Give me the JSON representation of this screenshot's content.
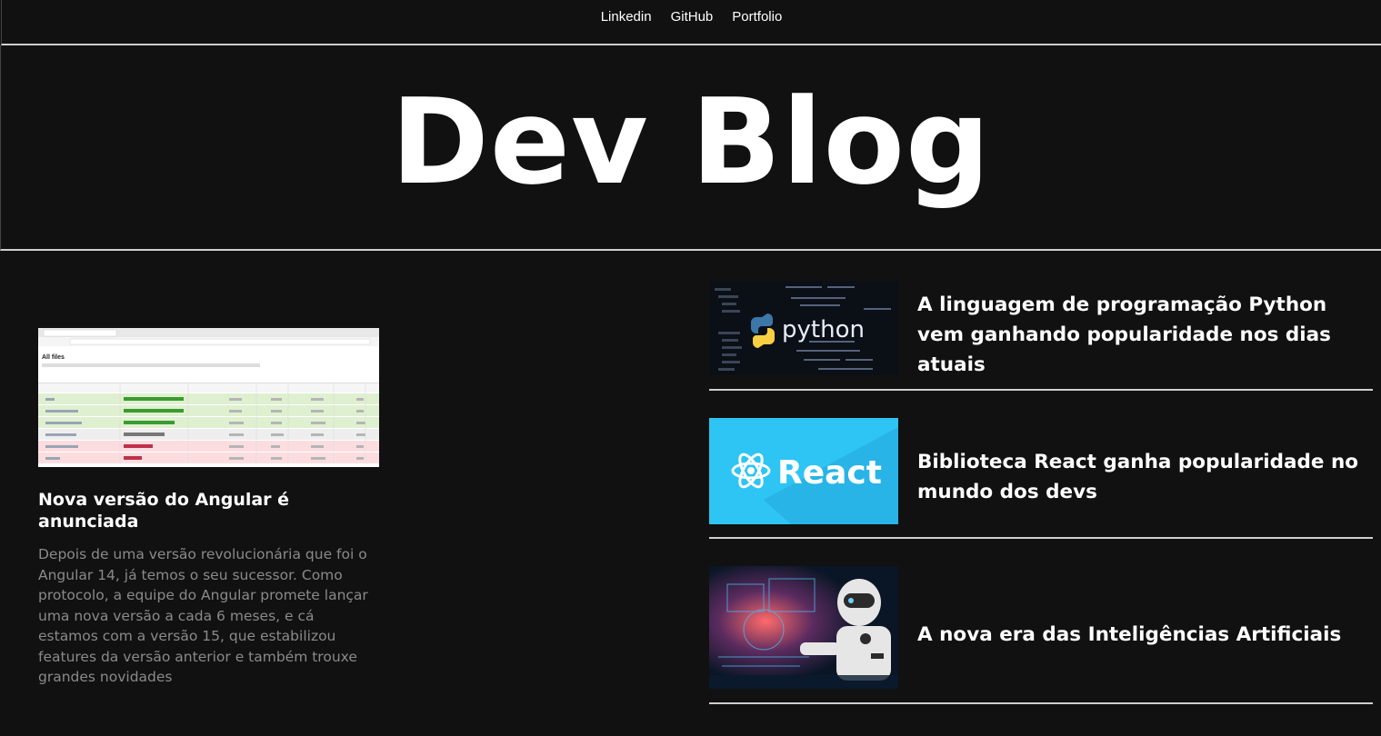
{
  "nav": {
    "links": [
      "Linkedin",
      "GitHub",
      "Portfolio"
    ]
  },
  "hero": {
    "title": "Dev Blog"
  },
  "feature": {
    "title": "Nova versão do Angular é anunciada",
    "description": "Depois de uma versão revolucionária que foi o Angular 14, já temos o seu sucessor. Como protocolo, a equipe do Angular promete lançar uma nova versão a cada 6 meses, e cá estamos com a versão 15, que estabilizou features da versão anterior e também trouxe grandes novidades",
    "image": {
      "heading": "All files"
    }
  },
  "posts": [
    {
      "title": "A linguagem de programação Python vem ganhando popularidade nos dias atuais",
      "thumb_text": "python",
      "icon": "python-logo-icon"
    },
    {
      "title": "Biblioteca React ganha popularidade no mundo dos devs",
      "thumb_text": "React",
      "icon": "react-logo-icon"
    },
    {
      "title": "A nova era das Inteligências Artificiais",
      "icon": "robot-image"
    }
  ],
  "colors": {
    "background": "#111111",
    "text": "#ffffff",
    "muted_text": "#8a8a8a",
    "divider": "#cfcfcf",
    "react_blue": "#29c3f2"
  }
}
